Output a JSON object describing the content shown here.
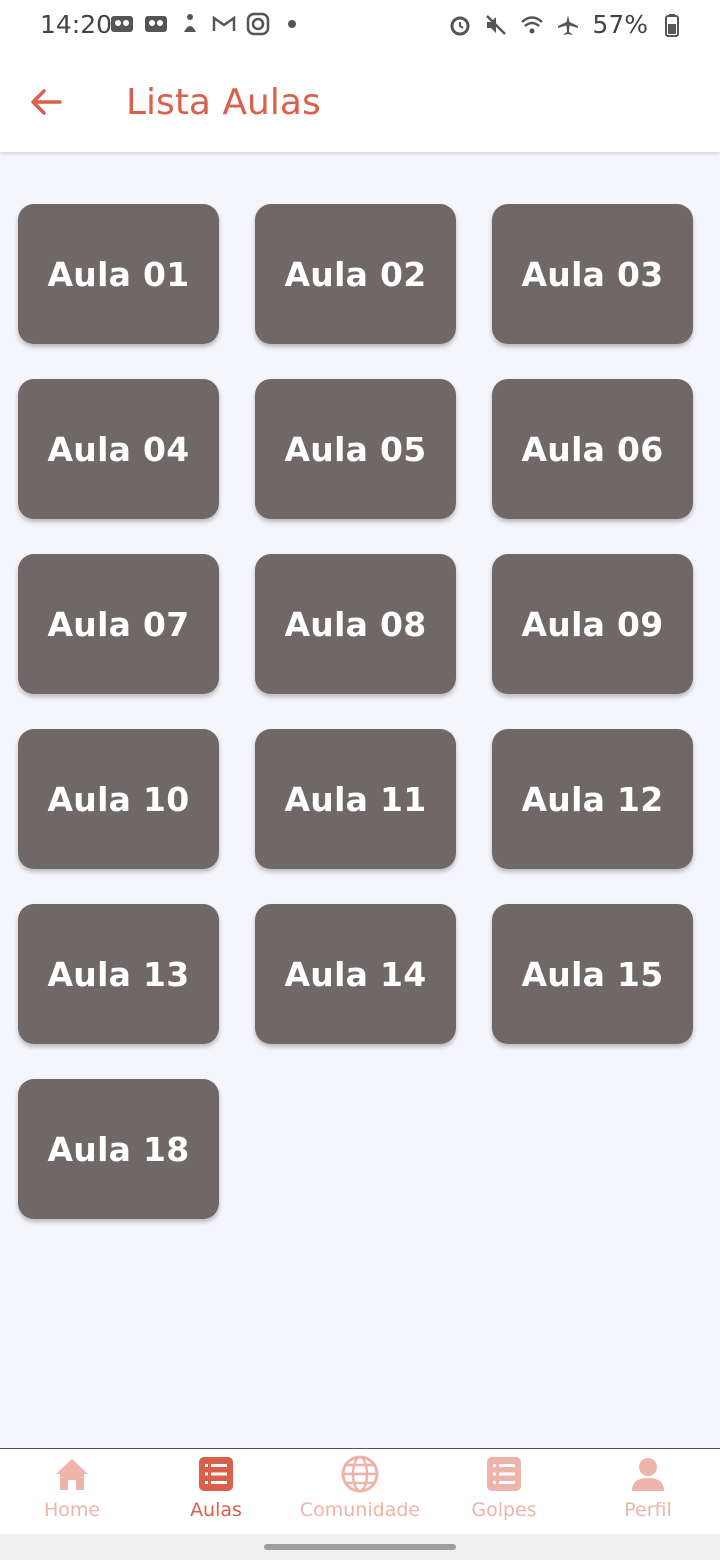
{
  "status_bar": {
    "time": "14:20",
    "battery": "57%"
  },
  "header": {
    "title": "Lista Aulas"
  },
  "lessons": [
    "Aula 01",
    "Aula 02",
    "Aula 03",
    "Aula 04",
    "Aula 05",
    "Aula 06",
    "Aula 07",
    "Aula 08",
    "Aula 09",
    "Aula 10",
    "Aula 11",
    "Aula 12",
    "Aula 13",
    "Aula 14",
    "Aula 15",
    "Aula 18"
  ],
  "bottom_nav": {
    "items": [
      {
        "label": "Home",
        "icon": "home-icon"
      },
      {
        "label": "Aulas",
        "icon": "list-icon"
      },
      {
        "label": "Comunidade",
        "icon": "globe-icon"
      },
      {
        "label": "Golpes",
        "icon": "list-icon"
      },
      {
        "label": "Perfil",
        "icon": "person-icon"
      }
    ],
    "active": "Aulas"
  },
  "colors": {
    "accent": "#d9604b",
    "accent_light": "#eeb4a9",
    "card": "#6f6867",
    "background": "#f5f6fc"
  }
}
